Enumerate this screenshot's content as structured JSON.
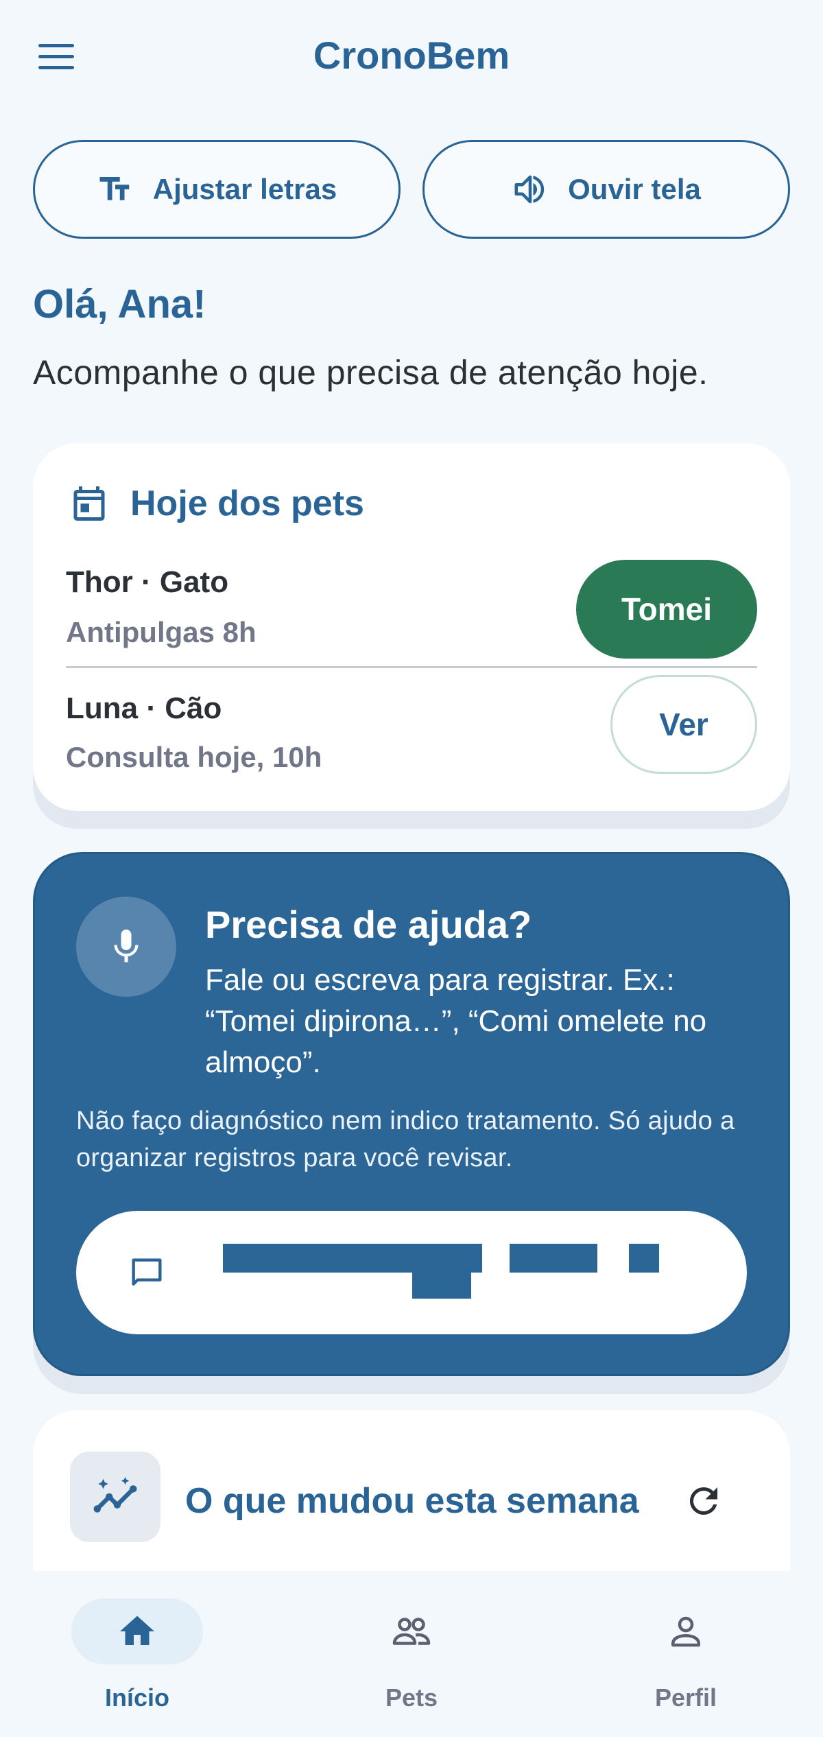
{
  "header": {
    "title": "CronoBem",
    "menu_icon": "hamburger-menu-icon"
  },
  "accessibility": {
    "adjust_text_label": "Ajustar letras",
    "adjust_text_icon": "text-size-icon",
    "listen_label": "Ouvir tela",
    "listen_icon": "speaker-icon"
  },
  "greeting": {
    "title": "Olá, Ana!",
    "subtitle": "Acompanhe o que precisa de atenção hoje."
  },
  "pets_today": {
    "title": "Hoje dos pets",
    "icon": "calendar-icon",
    "items": [
      {
        "name": "Thor · Gato",
        "info": "Antipulgas 8h",
        "action": "Tomei"
      },
      {
        "name": "Luna · Cão",
        "info": "Consulta hoje, 10h",
        "action": "Ver"
      }
    ]
  },
  "help": {
    "title": "Precisa de ajuda?",
    "icon": "microphone-icon",
    "body": "Fale ou escreva para registrar. Ex.: “Tomei dipirona…”, “Comi omelete no almoço”.",
    "disclaimer": "Não faço diagnóstico nem indico tratamento. Só ajudo a organizar registros para você revisar.",
    "input_icon": "chat-bubble-icon"
  },
  "weekly": {
    "title": "O que mudou esta semana",
    "icon": "trend-chart-icon",
    "refresh_icon": "refresh-icon"
  },
  "bottom_nav": {
    "items": [
      {
        "label": "Início",
        "icon": "home-icon",
        "active": true
      },
      {
        "label": "Pets",
        "icon": "people-icon",
        "active": false
      },
      {
        "label": "Perfil",
        "icon": "person-icon",
        "active": false
      }
    ]
  },
  "colors": {
    "primary": "#2a6496",
    "success": "#2a7a55",
    "background": "#f3f8fc",
    "help_card": "#2c6696"
  }
}
